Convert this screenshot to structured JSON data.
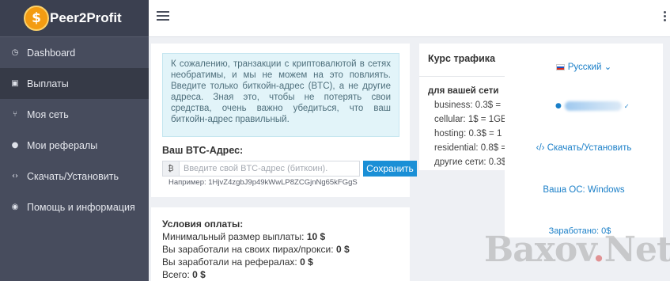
{
  "brand": {
    "logo_glyph": "$",
    "name": "Peer2Profit"
  },
  "sidebar": {
    "items": [
      {
        "label": "Dashboard",
        "icon": "dashboard-icon",
        "glyph": "◷"
      },
      {
        "label": "Выплаты",
        "icon": "payout-icon",
        "glyph": "▣",
        "active": true
      },
      {
        "label": "Моя сеть",
        "icon": "network-icon",
        "glyph": "⑂"
      },
      {
        "label": "Мои рефералы",
        "icon": "user-icon",
        "glyph": "●"
      },
      {
        "label": "Скачать/Установить",
        "icon": "code-icon",
        "glyph": "‹›"
      },
      {
        "label": "Помощь и информация",
        "icon": "help-icon",
        "glyph": "◉"
      }
    ]
  },
  "payout": {
    "notice": "К сожалению, транзакции с криптовалютой в сетях необратимы, и мы не можем на это повлиять. Введите только биткойн-адрес (BTC), а не другие адреса. Зная это, чтобы не потерять свои средства, очень важно убедиться, что ваш биткойн-адрес правильный.",
    "btc_label": "Ваш BTC-Адрес:",
    "btc_icon_glyph": "₿",
    "btc_placeholder": "Введите свой BTC-адрес (биткоин).",
    "save_label": "Сохранить",
    "example": "Например: 1HjvZ4zgbJ9p49kWwLP8ZCGjnNg65kFGgS"
  },
  "conditions": {
    "title": "Условия оплаты:",
    "min_label": "Минимальный размер выплаты:",
    "min_value": "10 $",
    "own_label": "Вы заработали на своих пирах/прокси:",
    "own_value": "0 $",
    "ref_label": "Вы заработали на рефералах:",
    "ref_value": "0 $",
    "total_label": "Всего:",
    "total_value": "0 $"
  },
  "traffic": {
    "title": "Курс трафика",
    "subtitle": "для вашей сети",
    "items": [
      "business: 0.3$ =",
      "cellular: 1$ = 1GB",
      "hosting: 0.3$ = 1",
      "residential: 0.8$ =",
      "другие сети: 0.3$"
    ]
  },
  "side": {
    "language": "Русский",
    "language_caret": "⌄",
    "user_glyph": "●",
    "verified_glyph": "✓",
    "download_glyph": "‹/›",
    "download": "Скачать/Установить",
    "os": "Ваша ОС: Windows",
    "earned": "Заработано: 0$"
  },
  "watermark": {
    "left": "Baxov",
    "dot": ".",
    "right": "Net"
  },
  "colors": {
    "sidebar": "#474c5d",
    "accent": "#1a8fd6",
    "notice_bg": "#e2f4f9"
  }
}
